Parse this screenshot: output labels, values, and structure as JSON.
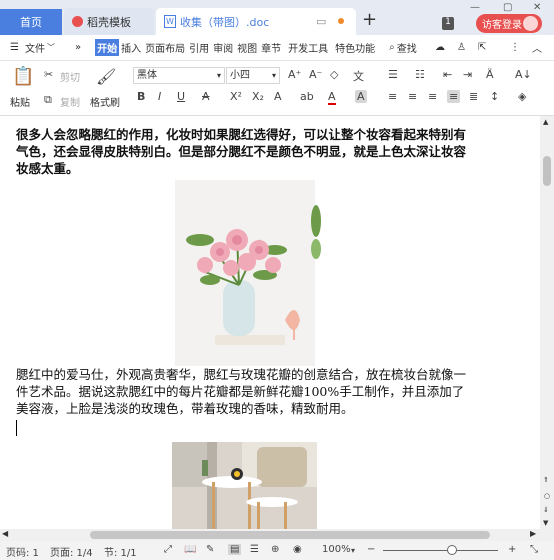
{
  "tabs": {
    "home": "首页",
    "template": "稻壳模板",
    "doc": "收集（带图）.doc"
  },
  "window": {
    "badge": "1",
    "login": "访客登录"
  },
  "menu": {
    "file": "文件",
    "items": [
      "开始",
      "插入",
      "页面布局",
      "引用",
      "审阅",
      "视图",
      "章节",
      "开发工具",
      "特色功能"
    ],
    "search": "查找"
  },
  "ribbon": {
    "paste": "粘贴",
    "cut": "剪切",
    "copy": "复制",
    "format_painter": "格式刷",
    "font_name": "黑体",
    "font_size": "小四",
    "bold": "B",
    "italic": "I",
    "underline": "U",
    "font_color": "A",
    "superscript": "X²",
    "subscript": "X₂",
    "char_shade": "A",
    "char_border": "A"
  },
  "document": {
    "para1": "很多人会忽略腮红的作用，化妆时如果腮红选得好，可以让整个妆容看起来特别有气色，还会显得皮肤特别白。但是部分腮红不是颜色不明显，就是上色太深让妆容妆感太重。",
    "para2": "腮红中的爱马仕，外观高贵奢华，腮红与玫瑰花瓣的创意结合，放在梳妆台就像一件艺术品。据说这款腮红中的每片花瓣都是新鲜花瓣100%手工制作，并且添加了美容液，上脸是浅淡的玫瑰色，带着玫瑰的香味，精致耐用。",
    "image1": "flower-vase-photo",
    "image2": "living-room-table-photo"
  },
  "status": {
    "page_num": "页码: 1",
    "page": "页面: 1/4",
    "section": "节: 1/1",
    "zoom": "100%",
    "zoom_level": 0.6
  },
  "colors": {
    "accent": "#4a7fe0",
    "login": "#e8504f"
  }
}
